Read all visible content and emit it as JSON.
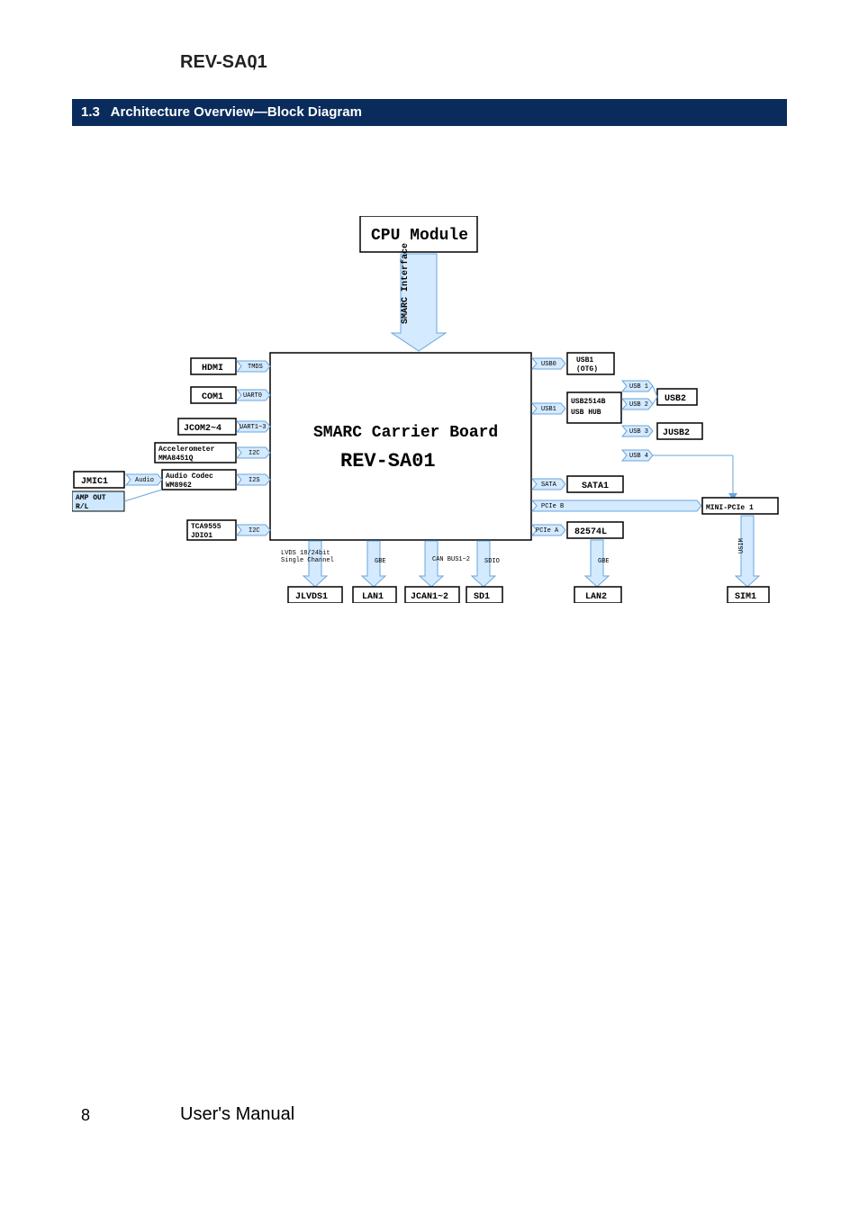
{
  "header": {
    "product": "REV-SA01"
  },
  "banner": {
    "section_num": "1.3",
    "section_title": "Architecture Overview—Block Diagram"
  },
  "diagram": {
    "cpu": "CPU Module",
    "smarc_if": "SMARC\nInterface",
    "carrier_title": "SMARC Carrier Board",
    "carrier_sub": "REV-SA01",
    "left": {
      "hdmi": "HDMI",
      "hdmi_bus": "TMDS",
      "com1": "COM1",
      "com1_bus": "UART0",
      "jcom": "JCOM2~4",
      "jcom_bus": "UART1~3",
      "accel": "Accelerometer\nMMA8451Q",
      "accel_bus": "I2C",
      "audio": "Audio Codec\nWM8962",
      "audio_bus": "I2S",
      "audio_out_bus": "Audio",
      "jmic": "JMIC1",
      "amp": "AMP OUT\nR/L",
      "tca": "TCA9555\nJDIO1",
      "tca_bus": "I2C"
    },
    "bottom": {
      "lvds_bus": "LVDS 18/24bit\nSingle Channel",
      "jlvds": "JLVDS1",
      "lan1": "LAN1",
      "lan1_bus": "GBE",
      "jcan": "JCAN1~2",
      "jcan_bus": "CAN BUS1~2",
      "sd1": "SD1",
      "sd1_bus": "SDIO"
    },
    "right": {
      "usb1": "USB1\n(OTG)",
      "usb1_bus": "USB0",
      "usbhub": "USB2514B\nUSB HUB",
      "usbhub_bus": "USB1",
      "usb2": "USB2",
      "usb2_port1": "USB 1",
      "usb2_port2": "USB 2",
      "jusb2": "JUSB2",
      "jusb2_port3": "USB 3",
      "jusb2_port4": "USB 4",
      "sata": "SATA1",
      "sata_bus": "SATA",
      "pcie_b": "PCIe  B",
      "minipcie": "MINI-PCIe 1",
      "lan2_chip": "82574L",
      "lan2_chip_bus": "PCIe  A",
      "lan2": "LAN2",
      "lan2_bus": "GBE",
      "sim": "SIM1",
      "sim_bus": "USIM"
    }
  },
  "footer": {
    "page": "8",
    "label": "User's Manual"
  }
}
